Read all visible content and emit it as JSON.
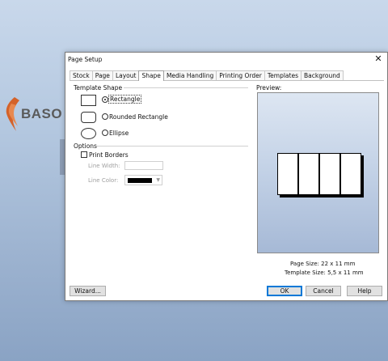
{
  "background": {
    "logo_text": "BASO"
  },
  "dialog": {
    "title": "Page Setup",
    "tabs": [
      {
        "label": "Stock"
      },
      {
        "label": "Page"
      },
      {
        "label": "Layout"
      },
      {
        "label": "Shape",
        "active": true
      },
      {
        "label": "Media Handling"
      },
      {
        "label": "Printing Order"
      },
      {
        "label": "Templates"
      },
      {
        "label": "Background"
      }
    ],
    "template_shape": {
      "group_label": "Template Shape",
      "options": [
        {
          "label": "Rectangle",
          "selected": true,
          "icon": "rectangle-icon"
        },
        {
          "label": "Rounded Rectangle",
          "selected": false,
          "icon": "rounded-rectangle-icon"
        },
        {
          "label": "Ellipse",
          "selected": false,
          "icon": "ellipse-icon"
        }
      ]
    },
    "options_group": {
      "group_label": "Options",
      "print_borders_label": "Print Borders",
      "print_borders_checked": false,
      "line_width_label": "Line Width:",
      "line_width_value": "",
      "line_color_label": "Line Color:",
      "line_color_value": "#000000"
    },
    "preview": {
      "label": "Preview:",
      "columns": 4
    },
    "info": {
      "page_size": "Page Size:  22 x 11 mm",
      "template_size": "Template Size:  5,5 x 11 mm"
    },
    "buttons": {
      "wizard": "Wizard...",
      "ok": "OK",
      "cancel": "Cancel",
      "help": "Help"
    }
  }
}
